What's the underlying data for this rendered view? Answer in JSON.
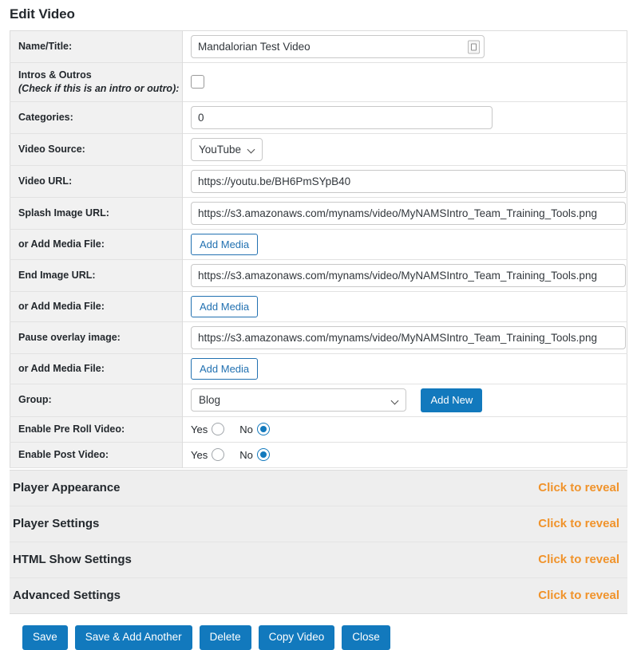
{
  "page": {
    "title": "Edit Video"
  },
  "form": {
    "rows": [
      {
        "label": "Name/Title:"
      },
      {
        "label": "Intros & Outros",
        "sublabel": "(Check if this is an intro or outro):"
      },
      {
        "label": "Categories:"
      },
      {
        "label": "Video Source:"
      },
      {
        "label": "Video URL:"
      },
      {
        "label": "Splash Image URL:"
      },
      {
        "label": "or Add Media File:"
      },
      {
        "label": "End Image URL:"
      },
      {
        "label": "or Add Media File:"
      },
      {
        "label": "Pause overlay image:"
      },
      {
        "label": "or Add Media File:"
      },
      {
        "label": "Group:"
      },
      {
        "label": "Enable Pre Roll Video:"
      },
      {
        "label": "Enable Post Video:"
      }
    ],
    "name_title": {
      "value": "Mandalorian Test Video",
      "grip_icon": "resize-grip-icon"
    },
    "intros_outros": {
      "checked": false
    },
    "categories": {
      "value": "0"
    },
    "video_source": {
      "value": "YouTube"
    },
    "video_url": {
      "value": "https://youtu.be/BH6PmSYpB40"
    },
    "splash_image_url": {
      "value": "https://s3.amazonaws.com/mynams/video/MyNAMSIntro_Team_Training_Tools.png"
    },
    "end_image_url": {
      "value": "https://s3.amazonaws.com/mynams/video/MyNAMSIntro_Team_Training_Tools.png"
    },
    "pause_overlay_image": {
      "value": "https://s3.amazonaws.com/mynams/video/MyNAMSIntro_Team_Training_Tools.png"
    },
    "add_media_label": "Add Media",
    "group": {
      "value": "Blog",
      "add_new_label": "Add New"
    },
    "radio_labels": {
      "yes": "Yes",
      "no": "No"
    },
    "enable_pre_roll": {
      "selected": "No"
    },
    "enable_post_video": {
      "selected": "No"
    }
  },
  "accordion": {
    "reveal_label": "Click to reveal",
    "sections": [
      {
        "title": "Player Appearance"
      },
      {
        "title": "Player Settings"
      },
      {
        "title": "HTML Show Settings"
      },
      {
        "title": "Advanced Settings"
      }
    ]
  },
  "footer": {
    "buttons": [
      {
        "label": "Save"
      },
      {
        "label": "Save & Add Another"
      },
      {
        "label": "Delete"
      },
      {
        "label": "Copy Video"
      },
      {
        "label": "Close"
      }
    ]
  },
  "colors": {
    "primary_blue": "#1279bd",
    "link_blue": "#2271b1",
    "reveal_orange": "#f0932b",
    "label_bg": "#f1f1f1",
    "accordion_bg": "#eeeeee"
  }
}
